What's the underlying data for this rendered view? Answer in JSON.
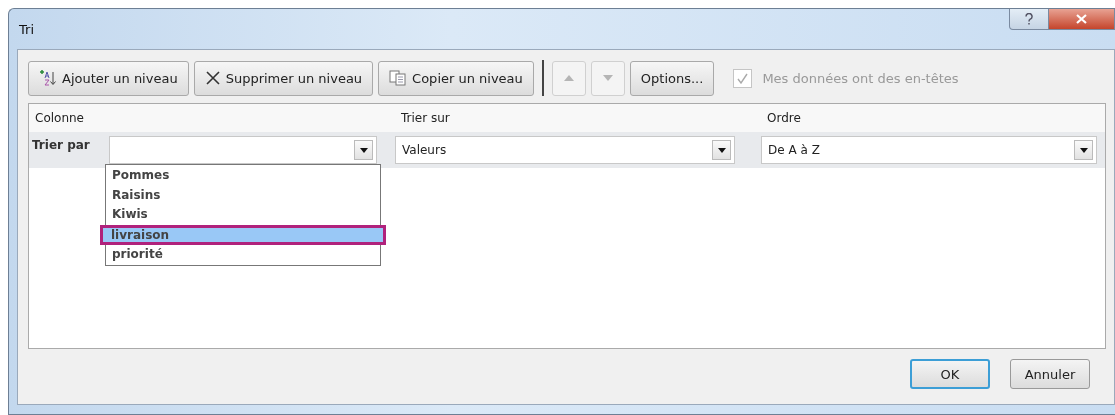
{
  "window": {
    "title": "Tri"
  },
  "toolbar": [
    {
      "kind": "add",
      "label": "Ajouter un niveau",
      "disabled": false
    },
    {
      "kind": "delete",
      "label": "Supprimer un niveau",
      "disabled": false
    },
    {
      "kind": "copy",
      "label": "Copier un niveau",
      "disabled": false
    },
    {
      "kind": "up",
      "disabled": true
    },
    {
      "kind": "down",
      "disabled": true
    },
    {
      "kind": "options",
      "label": "Options...",
      "disabled": false
    }
  ],
  "headers_checkbox": {
    "label": "Mes données ont des en-têtes",
    "checked": true,
    "disabled": true
  },
  "columns": [
    "Colonne",
    "Trier sur",
    "Ordre"
  ],
  "rows": [
    {
      "label": "Trier par",
      "column": {
        "expanded": true,
        "options": [
          {
            "label": "Pommes",
            "selected": false
          },
          {
            "label": "Raisins",
            "selected": false
          },
          {
            "label": "Kiwis",
            "selected": false
          },
          {
            "label": "livraison",
            "selected": true
          },
          {
            "label": "priorité",
            "selected": false
          }
        ]
      },
      "sort_on": {
        "value": "Valeurs"
      },
      "order": {
        "value": "De A à Z"
      }
    }
  ],
  "buttons": [
    {
      "label": "OK",
      "default": true
    },
    {
      "label": "Annuler",
      "default": false
    }
  ]
}
